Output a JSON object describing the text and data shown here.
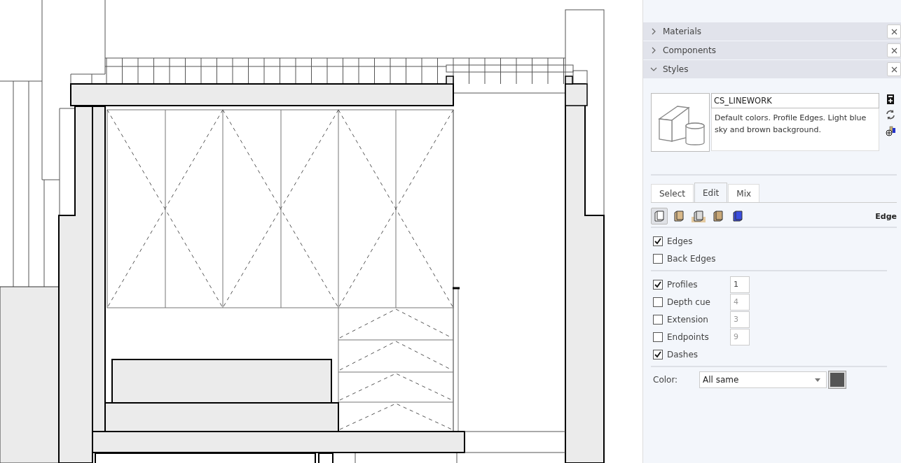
{
  "panels": [
    {
      "title": "Materials",
      "expanded": false
    },
    {
      "title": "Components",
      "expanded": false
    },
    {
      "title": "Styles",
      "expanded": true
    }
  ],
  "style": {
    "name": "CS_LINEWORK",
    "description": "Default colors. Profile Edges. Light blue sky and brown background."
  },
  "tabs": [
    {
      "label": "Select",
      "selected": false
    },
    {
      "label": "Edit",
      "selected": true
    },
    {
      "label": "Mix",
      "selected": false
    }
  ],
  "edit_toolbar": {
    "buttons": [
      {
        "kind": "edge",
        "selected": true
      },
      {
        "kind": "face",
        "selected": false
      },
      {
        "kind": "background",
        "selected": false
      },
      {
        "kind": "watermark",
        "selected": false
      },
      {
        "kind": "modeling",
        "selected": false
      }
    ],
    "section_label": "Edge"
  },
  "edge_groups": [
    {
      "items": [
        {
          "label": "Edges",
          "checked": true
        },
        {
          "label": "Back Edges",
          "checked": false
        }
      ]
    },
    {
      "items": [
        {
          "label": "Profiles",
          "checked": true,
          "value": "1"
        },
        {
          "label": "Depth cue",
          "checked": false,
          "value": "4"
        },
        {
          "label": "Extension",
          "checked": false,
          "value": "3"
        },
        {
          "label": "Endpoints",
          "checked": false,
          "value": "9"
        },
        {
          "label": "Dashes",
          "checked": true
        }
      ]
    }
  ],
  "color": {
    "label": "Color:",
    "value": "All same"
  }
}
